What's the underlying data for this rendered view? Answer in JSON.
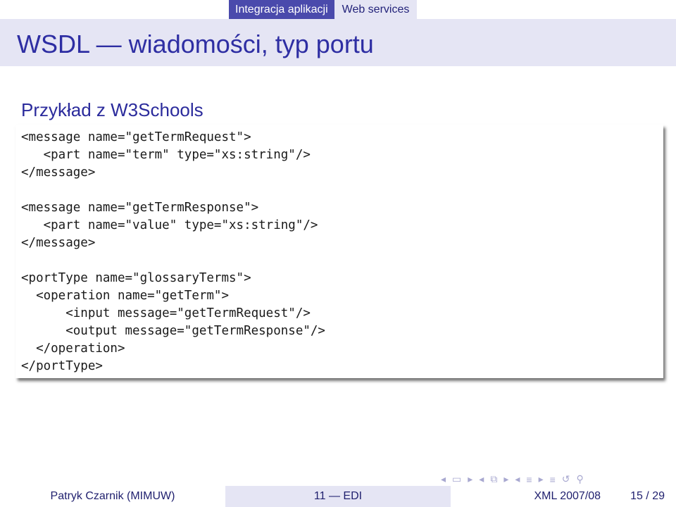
{
  "header": {
    "sections": [
      {
        "label": "Integracja aplikacji",
        "active": true
      },
      {
        "label": "Web services",
        "active": false
      }
    ]
  },
  "frame": {
    "title": "WSDL — wiadomości, typ portu"
  },
  "block": {
    "title": "Przykład z W3Schools",
    "code": [
      "<message name=\"getTermRequest\">",
      "   <part name=\"term\" type=\"xs:string\"/>",
      "</message>",
      "",
      "<message name=\"getTermResponse\">",
      "   <part name=\"value\" type=\"xs:string\"/>",
      "</message>",
      "",
      "<portType name=\"glossaryTerms\">",
      "  <operation name=\"getTerm\">",
      "      <input message=\"getTermRequest\"/>",
      "      <output message=\"getTermResponse\"/>",
      "  </operation>",
      "</portType>"
    ]
  },
  "nav": {
    "icons": [
      "nav-prev-frame-icon",
      "nav-frame-icon",
      "nav-next-frame-icon",
      "nav-prev-subsection-icon",
      "nav-subsection-icon",
      "nav-next-subsection-icon",
      "nav-prev-section-icon",
      "nav-section-icon",
      "nav-next-section-icon",
      "nav-align-icon",
      "nav-undo-icon",
      "nav-search-icon"
    ]
  },
  "footer": {
    "author": "Patryk Czarnik  (MIMUW)",
    "course": "11 — EDI",
    "date": "XML 2007/08",
    "page": "15 / 29"
  },
  "colors": {
    "active_tab": "#4a4aac",
    "inactive_tab": "#e5e5f4",
    "title_text": "#2e2ea3",
    "footer_mid": "#e5e5f4"
  }
}
